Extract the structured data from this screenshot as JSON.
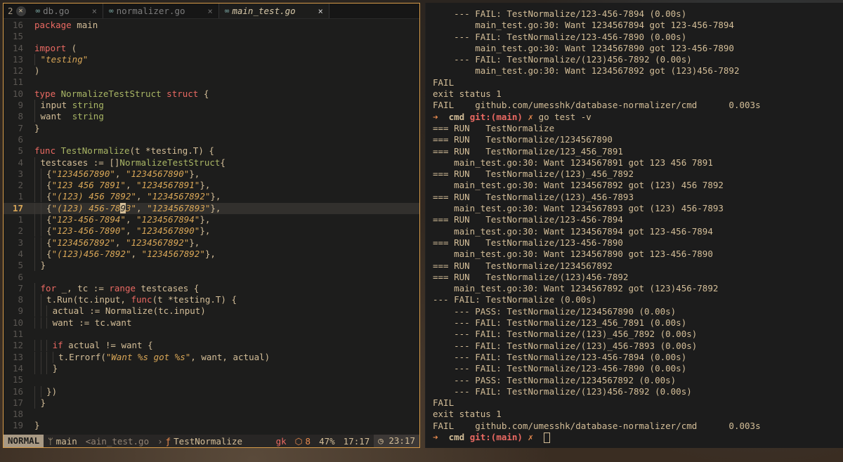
{
  "editor": {
    "tab_count": "2",
    "tabs": [
      {
        "name": "db.go",
        "close": "×",
        "active": false
      },
      {
        "name": "normalizer.go",
        "close": "×",
        "active": false
      },
      {
        "name": "main_test.go",
        "close": "×",
        "active": true
      }
    ],
    "lines": [
      {
        "n": "16",
        "html": "<span class=\"k\">package</span> main"
      },
      {
        "n": "15",
        "html": ""
      },
      {
        "n": "14",
        "html": "<span class=\"k\">import</span> ("
      },
      {
        "n": "13",
        "html": "<span class=\"guide\"></span> <span class=\"str\">\"testing\"</span>"
      },
      {
        "n": "12",
        "html": ")"
      },
      {
        "n": "11",
        "html": ""
      },
      {
        "n": "10",
        "html": "<span class=\"k\">type</span> <span class=\"ty\">NormalizeTestStruct</span> <span class=\"k\">struct</span> {"
      },
      {
        "n": "9",
        "html": "<span class=\"guide\"></span> input <span class=\"ty\">string</span>"
      },
      {
        "n": "8",
        "html": "<span class=\"guide\"></span> want  <span class=\"ty\">string</span>"
      },
      {
        "n": "7",
        "html": "}"
      },
      {
        "n": "6",
        "html": ""
      },
      {
        "n": "5",
        "html": "<span class=\"k\">func</span> <span class=\"fn\">TestNormalize</span>(t *testing.T) {"
      },
      {
        "n": "4",
        "html": "<span class=\"guide\"></span> testcases := []<span class=\"ty\">NormalizeTestStruct</span>{"
      },
      {
        "n": "3",
        "html": "<span class=\"guide\"></span> <span class=\"guide\"></span> {<span class=\"str\">\"1234567890\"</span>, <span class=\"str\">\"1234567890\"</span>},"
      },
      {
        "n": "2",
        "html": "<span class=\"guide\"></span> <span class=\"guide\"></span> {<span class=\"str\">\"123 456 7891\"</span>, <span class=\"str\">\"1234567891\"</span>},"
      },
      {
        "n": "1",
        "html": "<span class=\"guide\"></span> <span class=\"guide\"></span> {<span class=\"str\">\"(123) 456 7892\"</span>, <span class=\"str\">\"1234567892\"</span>},"
      },
      {
        "n": "17",
        "cur": true,
        "html": "<span class=\"guide\"></span> <span class=\"guide\"></span> {<span class=\"str\">\"(123) 456-78<span class=\"cursor\">9</span>3\"</span>, <span class=\"str\">\"1234567893\"</span>},"
      },
      {
        "n": "1",
        "html": "<span class=\"guide\"></span> <span class=\"guide\"></span> {<span class=\"str\">\"123-456-7894\"</span>, <span class=\"str\">\"1234567894\"</span>},"
      },
      {
        "n": "2",
        "html": "<span class=\"guide\"></span> <span class=\"guide\"></span> {<span class=\"str\">\"123-456-7890\"</span>, <span class=\"str\">\"1234567890\"</span>},"
      },
      {
        "n": "3",
        "html": "<span class=\"guide\"></span> <span class=\"guide\"></span> {<span class=\"str\">\"1234567892\"</span>, <span class=\"str\">\"1234567892\"</span>},"
      },
      {
        "n": "4",
        "html": "<span class=\"guide\"></span> <span class=\"guide\"></span> {<span class=\"str\">\"(123)456-7892\"</span>, <span class=\"str\">\"1234567892\"</span>},"
      },
      {
        "n": "5",
        "html": "<span class=\"guide\"></span> }"
      },
      {
        "n": "6",
        "html": ""
      },
      {
        "n": "7",
        "html": "<span class=\"guide\"></span> <span class=\"k\">for</span> _, tc := <span class=\"k\">range</span> testcases {"
      },
      {
        "n": "8",
        "html": "<span class=\"guide\"></span> <span class=\"guide\"></span> t.Run(tc.input, <span class=\"k\">func</span>(t *testing.T) {"
      },
      {
        "n": "9",
        "html": "<span class=\"guide\"></span> <span class=\"guide\"></span> <span class=\"guide\"></span> actual := Normalize(tc.input)"
      },
      {
        "n": "10",
        "html": "<span class=\"guide\"></span> <span class=\"guide\"></span> <span class=\"guide\"></span> want := tc.want"
      },
      {
        "n": "11",
        "html": ""
      },
      {
        "n": "12",
        "html": "<span class=\"guide\"></span> <span class=\"guide\"></span> <span class=\"guide\"></span> <span class=\"k\">if</span> actual != want {"
      },
      {
        "n": "13",
        "html": "<span class=\"guide\"></span> <span class=\"guide\"></span> <span class=\"guide\"></span> <span class=\"guide\"></span> t.Errorf(<span class=\"str\">\"Want %s got %s\"</span>, want, actual)"
      },
      {
        "n": "14",
        "html": "<span class=\"guide\"></span> <span class=\"guide\"></span> <span class=\"guide\"></span> }"
      },
      {
        "n": "15",
        "html": ""
      },
      {
        "n": "16",
        "html": "<span class=\"guide\"></span> <span class=\"guide\"></span> })"
      },
      {
        "n": "17",
        "html": "<span class=\"guide\"></span> }"
      },
      {
        "n": "18",
        "html": ""
      },
      {
        "n": "19",
        "html": "}"
      }
    ],
    "status": {
      "mode": "NORMAL",
      "branch_icon": "git-branch-icon",
      "branch": "main",
      "file": "<ain_test.go",
      "func_icon": "function-icon",
      "func": "TestNormalize",
      "gk": "gk",
      "diag_icon": "package-icon",
      "diag_count": "8",
      "percent": "47%",
      "position": "17:17",
      "clock_icon": "clock-icon",
      "time": "23:17"
    }
  },
  "terminal": {
    "lines": [
      "    --- FAIL: TestNormalize/123-456-7894 (0.00s)",
      "        main_test.go:30: Want 1234567894 got 123-456-7894",
      "    --- FAIL: TestNormalize/123-456-7890 (0.00s)",
      "        main_test.go:30: Want 1234567890 got 123-456-7890",
      "    --- FAIL: TestNormalize/(123)456-7892 (0.00s)",
      "        main_test.go:30: Want 1234567892 got (123)456-7892",
      "FAIL",
      "exit status 1",
      "FAIL    github.com/umesshk/database-normalizer/cmd      0.003s",
      "__PROMPT1__",
      "=== RUN   TestNormalize",
      "=== RUN   TestNormalize/1234567890",
      "=== RUN   TestNormalize/123_456_7891",
      "    main_test.go:30: Want 1234567891 got 123 456 7891",
      "=== RUN   TestNormalize/(123)_456_7892",
      "    main_test.go:30: Want 1234567892 got (123) 456 7892",
      "=== RUN   TestNormalize/(123)_456-7893",
      "    main_test.go:30: Want 1234567893 got (123) 456-7893",
      "=== RUN   TestNormalize/123-456-7894",
      "    main_test.go:30: Want 1234567894 got 123-456-7894",
      "=== RUN   TestNormalize/123-456-7890",
      "    main_test.go:30: Want 1234567890 got 123-456-7890",
      "=== RUN   TestNormalize/1234567892",
      "=== RUN   TestNormalize/(123)456-7892",
      "    main_test.go:30: Want 1234567892 got (123)456-7892",
      "--- FAIL: TestNormalize (0.00s)",
      "    --- PASS: TestNormalize/1234567890 (0.00s)",
      "    --- FAIL: TestNormalize/123_456_7891 (0.00s)",
      "    --- FAIL: TestNormalize/(123)_456_7892 (0.00s)",
      "    --- FAIL: TestNormalize/(123)_456-7893 (0.00s)",
      "    --- FAIL: TestNormalize/123-456-7894 (0.00s)",
      "    --- FAIL: TestNormalize/123-456-7890 (0.00s)",
      "    --- PASS: TestNormalize/1234567892 (0.00s)",
      "    --- FAIL: TestNormalize/(123)456-7892 (0.00s)",
      "FAIL",
      "exit status 1",
      "FAIL    github.com/umesshk/database-normalizer/cmd      0.003s",
      "__PROMPT2__"
    ],
    "prompt1": {
      "arrow": "➜",
      "dir": "cmd",
      "git": "git:(main)",
      "x": "✗",
      "cmd": "go test -v"
    },
    "prompt2": {
      "arrow": "➜",
      "dir": "cmd",
      "git": "git:(main)",
      "x": "✗",
      "cmd": ""
    }
  }
}
